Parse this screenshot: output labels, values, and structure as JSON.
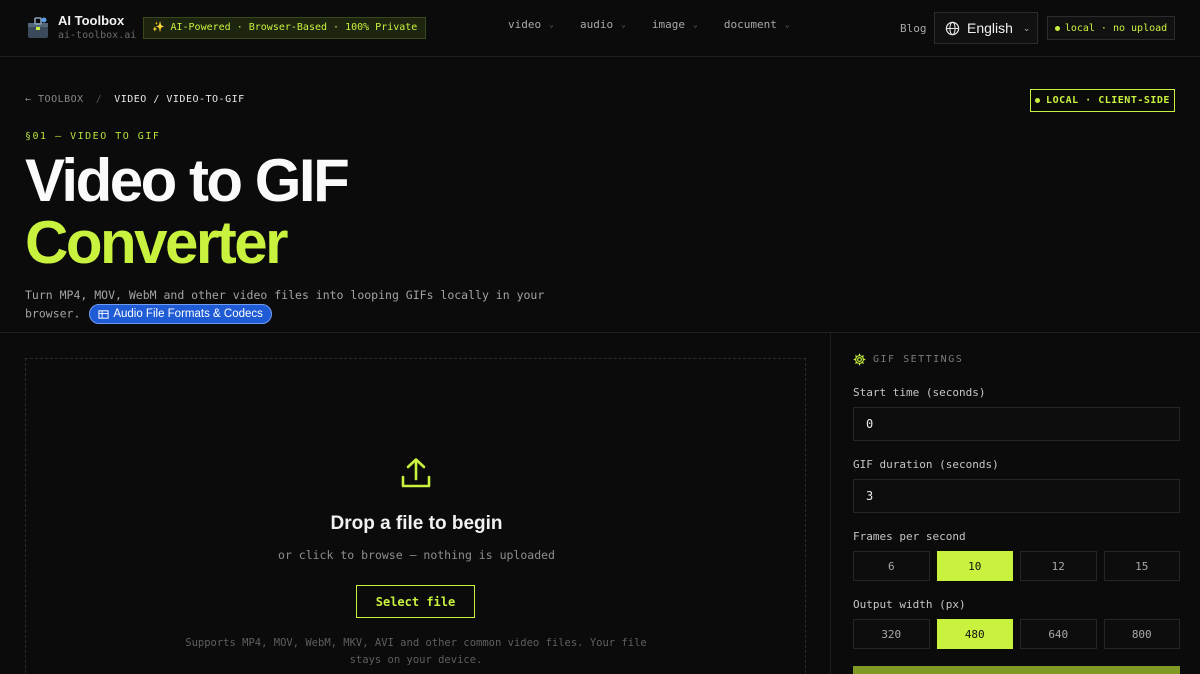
{
  "header": {
    "brand_title": "AI Toolbox",
    "brand_domain": "ai-toolbox.ai",
    "tagline": "✨ AI-Powered · Browser-Based · 100% Private",
    "nav": [
      {
        "label": "video"
      },
      {
        "label": "audio"
      },
      {
        "label": "image"
      },
      {
        "label": "document"
      }
    ],
    "blog": "Blog",
    "language": "English",
    "status_pill": "local · no upload"
  },
  "breadcrumb": {
    "back": "← TOOLBOX",
    "separator": "/",
    "current": "VIDEO / VIDEO-TO-GIF"
  },
  "badge": "LOCAL · CLIENT-SIDE",
  "hero": {
    "section_label": "§01 — VIDEO TO GIF",
    "title_line1": "Video to GIF",
    "title_line2": "Converter",
    "description": "Turn MP4, MOV, WebM and other video files into looping GIFs locally in your browser.",
    "chip": "Audio File Formats & Codecs"
  },
  "dropzone": {
    "title": "Drop a file to begin",
    "subtitle": "or click to browse — nothing is uploaded",
    "button": "Select file",
    "note": "Supports MP4, MOV, WebM, MKV, AVI and other common video files. Your file stays on your device."
  },
  "settings": {
    "heading": "GIF SETTINGS",
    "start_label": "Start time (seconds)",
    "start_value": "0",
    "duration_label": "GIF duration (seconds)",
    "duration_value": "3",
    "fps_label": "Frames per second",
    "fps_options": [
      "6",
      "10",
      "12",
      "15"
    ],
    "fps_selected": "10",
    "width_label": "Output width (px)",
    "width_options": [
      "320",
      "480",
      "640",
      "800"
    ],
    "width_selected": "480"
  },
  "colors": {
    "accent": "#c9f23e",
    "background": "#0b0b0b",
    "chip_blue": "#1e5bd4"
  }
}
